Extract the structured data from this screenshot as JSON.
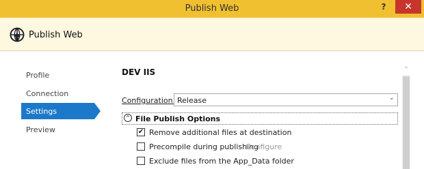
{
  "window": {
    "title": "Publish Web",
    "help_label": "?",
    "close_label": "✕"
  },
  "header": {
    "title": "Publish Web",
    "icon": "globe-upload-icon"
  },
  "nav": {
    "items": [
      {
        "label": "Profile"
      },
      {
        "label": "Connection"
      },
      {
        "label": "Settings",
        "selected": true
      },
      {
        "label": "Preview"
      }
    ]
  },
  "main": {
    "profile_name": "DEV IIS",
    "configuration": {
      "label": "Configuration:",
      "value": "Release"
    },
    "file_publish_options": {
      "title": "File Publish Options",
      "collapse_symbol": "^",
      "options": [
        {
          "label": "Remove additional files at destination",
          "checked": true
        },
        {
          "label": "Precompile during publishing",
          "checked": false,
          "link": "Configure"
        },
        {
          "label": "Exclude files from the App_Data folder",
          "checked": false
        }
      ]
    }
  },
  "colors": {
    "accent": "#1c79c9",
    "title_bar": "#f0c030",
    "close_button": "#c7352c",
    "header_bg": "#fdf8df"
  }
}
